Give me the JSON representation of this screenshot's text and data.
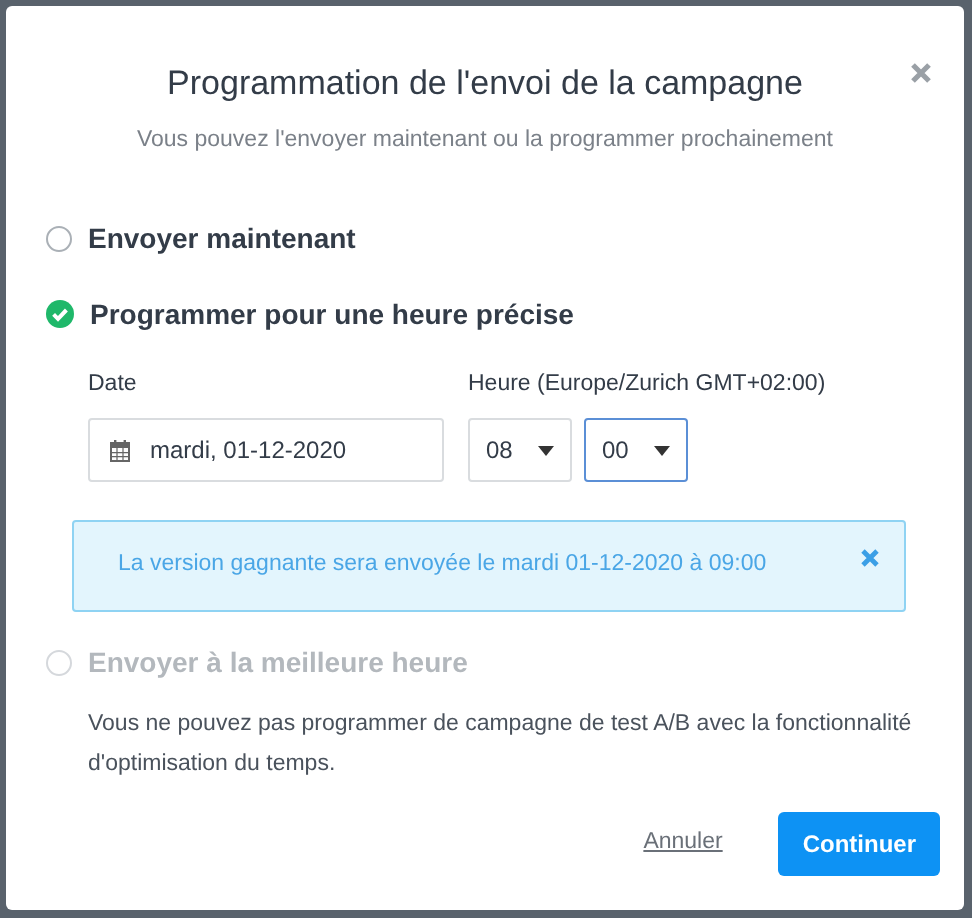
{
  "dialog": {
    "title": "Programmation de l'envoi de la campagne",
    "subtitle": "Vous pouvez l'envoyer maintenant ou la programmer prochainement"
  },
  "options": [
    {
      "label": "Envoyer maintenant",
      "selected": false,
      "disabled": false
    },
    {
      "label": "Programmer pour une heure précise",
      "selected": true,
      "disabled": false
    },
    {
      "label": "Envoyer à la meilleure heure",
      "selected": false,
      "disabled": true
    }
  ],
  "schedule": {
    "date_label": "Date",
    "date_value": "mardi, 01-12-2020",
    "time_label": "Heure (Europe/Zurich GMT+02:00)",
    "hour": "08",
    "minute": "00",
    "minute_focused": true
  },
  "alert": {
    "text": "La version gagnante sera envoyée le mardi 01-12-2020 à 09:00"
  },
  "note": "Vous ne pouvez pas programmer de campagne de test A/B avec la fonctionnalité d'optimisation du temps.",
  "buttons": {
    "cancel": "Annuler",
    "continue": "Continuer"
  }
}
